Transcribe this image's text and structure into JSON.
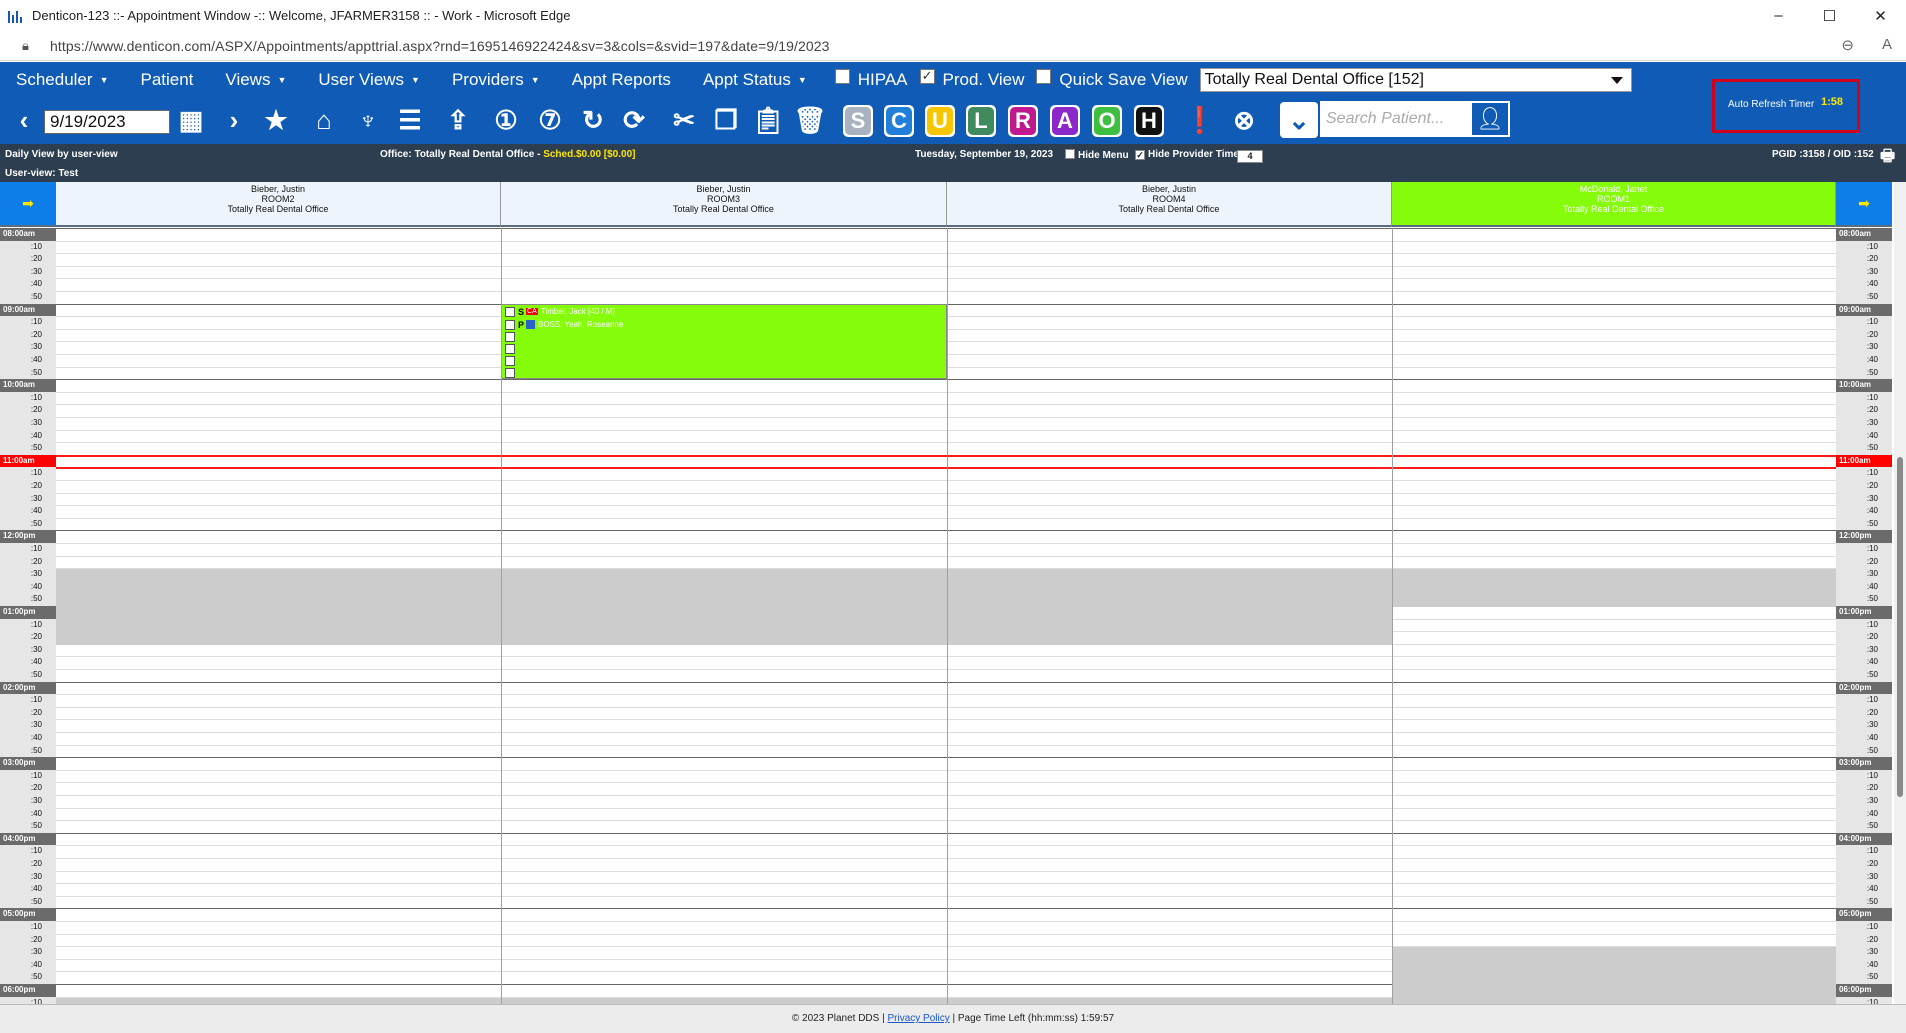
{
  "window": {
    "title": "Denticon-123 ::- Appointment Window -:: Welcome, JFARMER3158 :: - Work - Microsoft Edge",
    "minimize": "–",
    "maximize": "☐",
    "close": "✕"
  },
  "browser": {
    "url": "https://www.denticon.com/ASPX/Appointments/appttrial.aspx?rnd=1695146922424&sv=3&cols=&svid=197&date=9/19/2023"
  },
  "menu": {
    "items": [
      {
        "label": "Scheduler",
        "caret": true
      },
      {
        "label": "Patient",
        "caret": false
      },
      {
        "label": "Views",
        "caret": true
      },
      {
        "label": "User Views",
        "caret": true
      },
      {
        "label": "Providers",
        "caret": true
      },
      {
        "label": "Appt Reports",
        "caret": false
      },
      {
        "label": "Appt Status",
        "caret": true
      }
    ],
    "caret_glyph": "▼",
    "hipaa_label": "HIPAA",
    "hipaa_checked": false,
    "prod_view_label": "Prod. View",
    "prod_view_checked": true,
    "quick_save_label": "Quick Save View",
    "quick_save_checked": false,
    "office_select": "Totally Real Dental Office [152]"
  },
  "toolbar": {
    "date": "9/19/2023",
    "search_placeholder": "Search Patient...",
    "status_letters": [
      {
        "letter": "S",
        "color": "#a9b3c0"
      },
      {
        "letter": "C",
        "color": "#1f7fd9"
      },
      {
        "letter": "U",
        "color": "#f6c700"
      },
      {
        "letter": "L",
        "color": "#3f8b5e"
      },
      {
        "letter": "R",
        "color": "#c0198e"
      },
      {
        "letter": "A",
        "color": "#8b28c9"
      },
      {
        "letter": "O",
        "color": "#3fbf3f"
      },
      {
        "letter": "H",
        "color": "#111111"
      }
    ],
    "auto_refresh_label": "Auto Refresh Timer",
    "auto_refresh_value": "1:58"
  },
  "info": {
    "view": "Daily View by user-view",
    "office_prefix": "Office: Totally Real Dental Office - ",
    "sched": "Sched.$0.00 [$0.00]",
    "date": "Tuesday, September 19, 2023",
    "hide_menu": "Hide Menu",
    "hide_menu_checked": false,
    "hide_provider_time": "Hide Provider Time",
    "hide_provider_time_checked": true,
    "zoom": "4",
    "pgid": "PGID :3158  /  OID :152",
    "user_view": "User-view: Test"
  },
  "columns": [
    {
      "provider": "Bieber, Justin",
      "room": "ROOM2",
      "office": "Totally Real Dental Office",
      "highlight": false
    },
    {
      "provider": "Bieber, Justin",
      "room": "ROOM3",
      "office": "Totally Real Dental Office",
      "highlight": false
    },
    {
      "provider": "Bieber, Justin",
      "room": "ROOM4",
      "office": "Totally Real Dental Office",
      "highlight": false
    },
    {
      "provider": "McDonald, Janet",
      "room": "ROOM1",
      "office": "Totally Real Dental Office",
      "highlight": true
    }
  ],
  "times": {
    "hours": [
      "08:00am",
      "09:00am",
      "10:00am",
      "11:00am",
      "12:00pm",
      "01:00pm",
      "02:00pm",
      "03:00pm",
      "04:00pm",
      "05:00pm",
      "06:00pm"
    ],
    "minutes": [
      ":10",
      ":20",
      ":30",
      ":40",
      ":50"
    ],
    "current_hour": "11:00am"
  },
  "appointment": {
    "status_letter": "S",
    "status_code": "CA",
    "patient": "Timber, Jack [40 / M]",
    "second_letter": "P",
    "detail": "BOSS: Yeah, Roseanne"
  },
  "footer": {
    "copyright": "© 2023 Planet DDS | ",
    "privacy": "Privacy Policy",
    "time_left": " | Page Time Left (hh:mm:ss) 1:59:57"
  }
}
